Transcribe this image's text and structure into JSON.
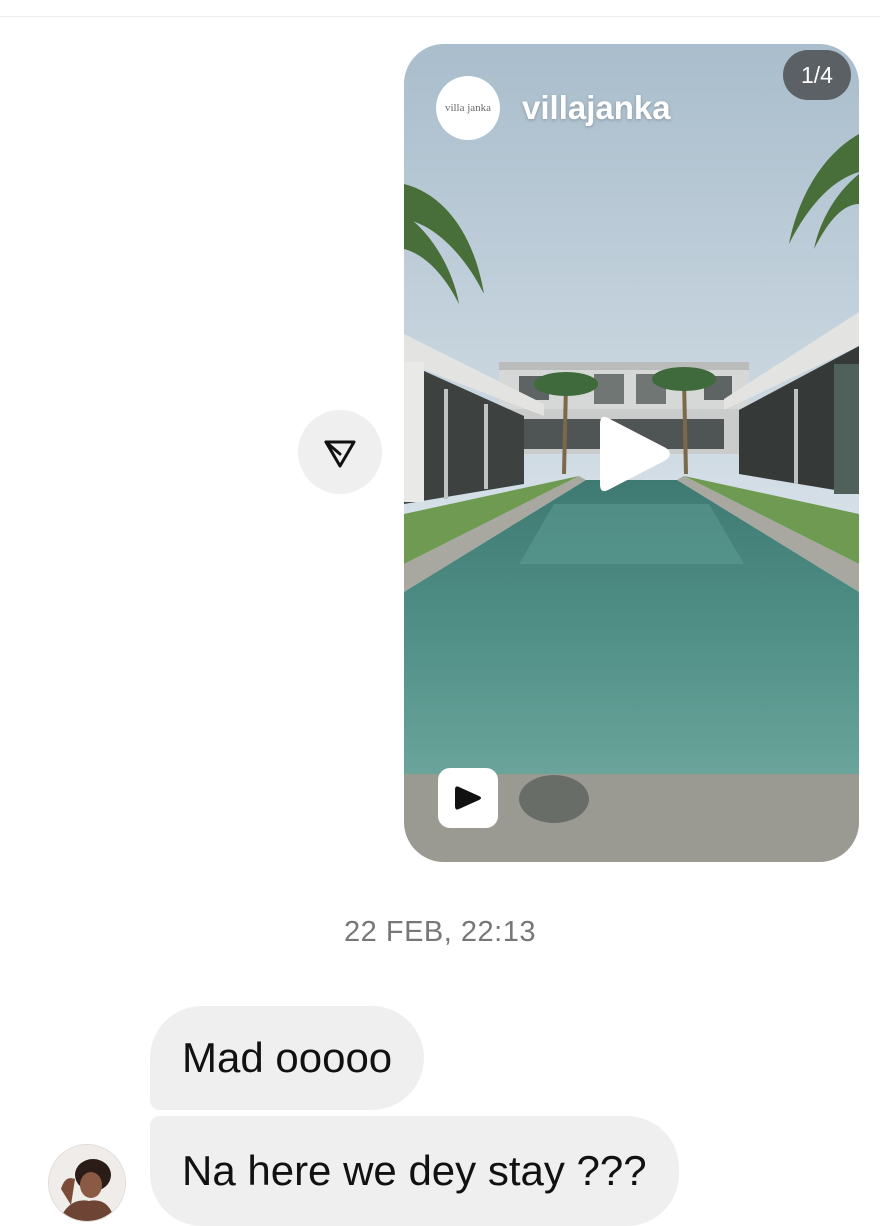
{
  "reel": {
    "username": "villajanka",
    "avatar_text": "villa janka",
    "page_counter": "1/4",
    "icons": {
      "play": "play-icon",
      "reel": "reel-icon",
      "share": "send-icon"
    }
  },
  "conversation": {
    "timestamp": "22 FEB, 22:13",
    "messages": [
      {
        "text": "Mad ooooo"
      },
      {
        "text": "Na here we dey stay ???"
      }
    ]
  },
  "colors": {
    "bubble": "#efefef",
    "timestamp": "#777777",
    "counter_bg": "#3c3c3c"
  }
}
